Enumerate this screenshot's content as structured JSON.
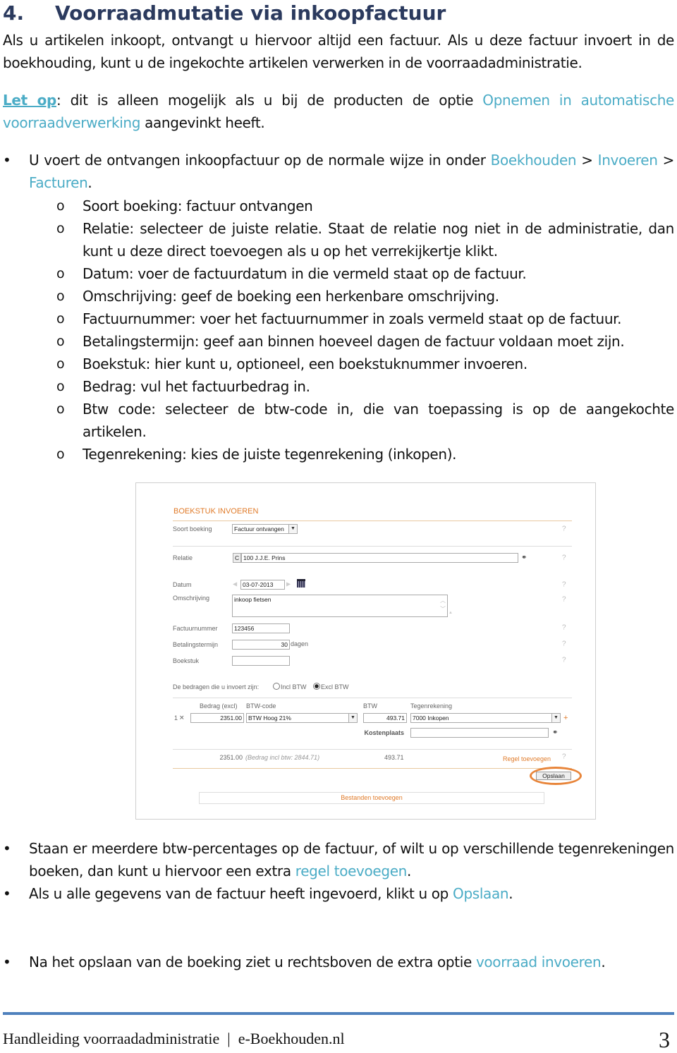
{
  "heading": {
    "number": "4.",
    "title": "Voorraadmutatie via inkoopfactuur"
  },
  "intro": "Als u artikelen inkoopt, ontvangt u hiervoor altijd een factuur. Als u deze factuur invoert in de boekhouding, kunt u de ingekochte artikelen verwerken in de voorraadadministratie.",
  "note": {
    "label": "Let op",
    "text1": ": dit is alleen mogelijk als u bij de producten de optie ",
    "link": "Opnemen in automatische voorraadverwerking",
    "text2": " aangevinkt heeft."
  },
  "bullet1": {
    "text": "U voert de ontvangen inkoopfactuur op de normale wijze in onder ",
    "path": [
      "Boekhouden",
      "Invoeren",
      "Facturen"
    ],
    "sep": " > ",
    "end": "."
  },
  "sub_items": [
    "Soort boeking: factuur ontvangen",
    "Relatie: selecteer de juiste relatie. Staat de relatie nog niet in de administratie, dan kunt u deze direct toevoegen als u op het verrekijkertje klikt.",
    "Datum: voer de factuurdatum in die vermeld staat op de factuur.",
    "Omschrijving: geef de boeking een herkenbare omschrijving.",
    "Factuurnummer: voer het factuurnummer in zoals vermeld staat op de factuur.",
    "Betalingstermijn: geef aan binnen hoeveel dagen de factuur voldaan moet zijn.",
    "Boekstuk: hier kunt u, optioneel, een boekstuknummer invoeren.",
    "Bedrag: vul het factuurbedrag in.",
    "Btw code: selecteer de btw-code in, die van toepassing is op de aangekochte artikelen.",
    "Tegenrekening: kies de juiste tegenrekening (inkopen)."
  ],
  "sub_bullet_glyph": "o",
  "form": {
    "title": "BOEKSTUK INVOEREN",
    "soort_label": "Soort boeking",
    "soort_value": "Factuur ontvangen",
    "relatie_label": "Relatie",
    "relatie_prefix": "C",
    "relatie_value": "100 J.J.E. Prins",
    "datum_label": "Datum",
    "datum_value": "03-07-2013",
    "omschrijving_label": "Omschrijving",
    "omschrijving_value": "inkoop fietsen",
    "factuurnummer_label": "Factuurnummer",
    "factuurnummer_value": "123456",
    "betalingstermijn_label": "Betalingstermijn",
    "betalingstermijn_value": "30",
    "betalingstermijn_unit": "dagen",
    "boekstuk_label": "Boekstuk",
    "boekstuk_value": "",
    "help": "?",
    "amounts_label": "De bedragen die u invoert zijn:",
    "incl_label": "Incl BTW",
    "excl_label": "Excl BTW",
    "excl_selected": true,
    "col_bedrag": "Bedrag (excl)",
    "col_btwcode": "BTW-code",
    "col_btw": "BTW",
    "col_tegen": "Tegenrekening",
    "row_num": "1",
    "row_bedrag": "2351.00",
    "row_btwcode": "BTW Hoog 21%",
    "row_btw": "493.71",
    "row_tegen": "7000 Inkopen",
    "kostenplaats_label": "Kostenplaats",
    "kostenplaats_value": "",
    "total_bedrag": "2351.00",
    "total_incl": "(Bedrag incl btw: 2844.71)",
    "total_btw": "493.71",
    "regel_toevoegen": "Regel toevoegen",
    "opslaan": "Opslaan",
    "bestanden": "Bestanden toevoegen",
    "accent": "#e07b2a"
  },
  "bullet2": {
    "text": "Staan er meerdere btw-percentages op de factuur, of wilt u op verschillende tegenrekeningen boeken, dan kunt u hiervoor een extra ",
    "link": "regel toevoegen",
    "end": "."
  },
  "bullet3": {
    "text": "Als u alle gegevens van de factuur heeft ingevoerd, klikt u op ",
    "link": "Opslaan",
    "end": "."
  },
  "bullet4": {
    "text": "Na het opslaan van de boeking ziet u rechtsboven de extra optie ",
    "link": "voorraad invoeren",
    "end": "."
  },
  "bullet_glyph": "•",
  "footer": {
    "text": "Handleiding voorraadadministratie  |  e-Boekhouden.nl",
    "page": "3"
  },
  "colors": {
    "heading": "#2b3a5e",
    "link": "#4bacc6",
    "rule": "#4f81bd"
  }
}
